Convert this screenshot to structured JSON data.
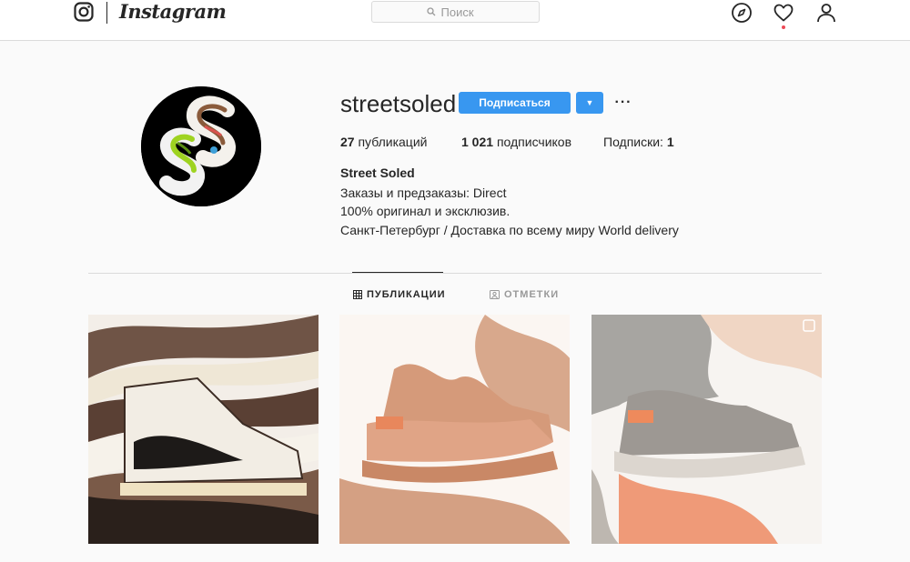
{
  "app": {
    "wordmark": "Instagram"
  },
  "search": {
    "placeholder": "Поиск",
    "icon": "search-icon"
  },
  "nav": {
    "icons": [
      "explore-compass-icon",
      "activity-heart-icon",
      "profile-icon"
    ]
  },
  "profile": {
    "username": "streetsoled",
    "follow_label": "Подписаться",
    "dropdown_label": "▼",
    "more_label": "···",
    "stats": {
      "posts_count": "27",
      "posts_label": "публикаций",
      "followers_count": "1 021",
      "followers_label": "подписчиков",
      "following_label": "Подписки:",
      "following_count": "1"
    },
    "bio": {
      "name": "Street Soled",
      "line1": "Заказы и предзаказы: Direct",
      "line2": "100% оригинал и эксклюзив.",
      "line3": "Санкт-Петербург / Доставка по всему миру World delivery"
    }
  },
  "tabs": [
    {
      "label": "ПУБЛИКАЦИИ",
      "icon": "grid-icon",
      "active": true
    },
    {
      "label": "ОТМЕТКИ",
      "icon": "tagged-icon",
      "active": false
    }
  ],
  "colors": {
    "accent": "#3897f0",
    "notification": "#ed4956",
    "text": "#262626",
    "border": "#dbdbdb"
  }
}
